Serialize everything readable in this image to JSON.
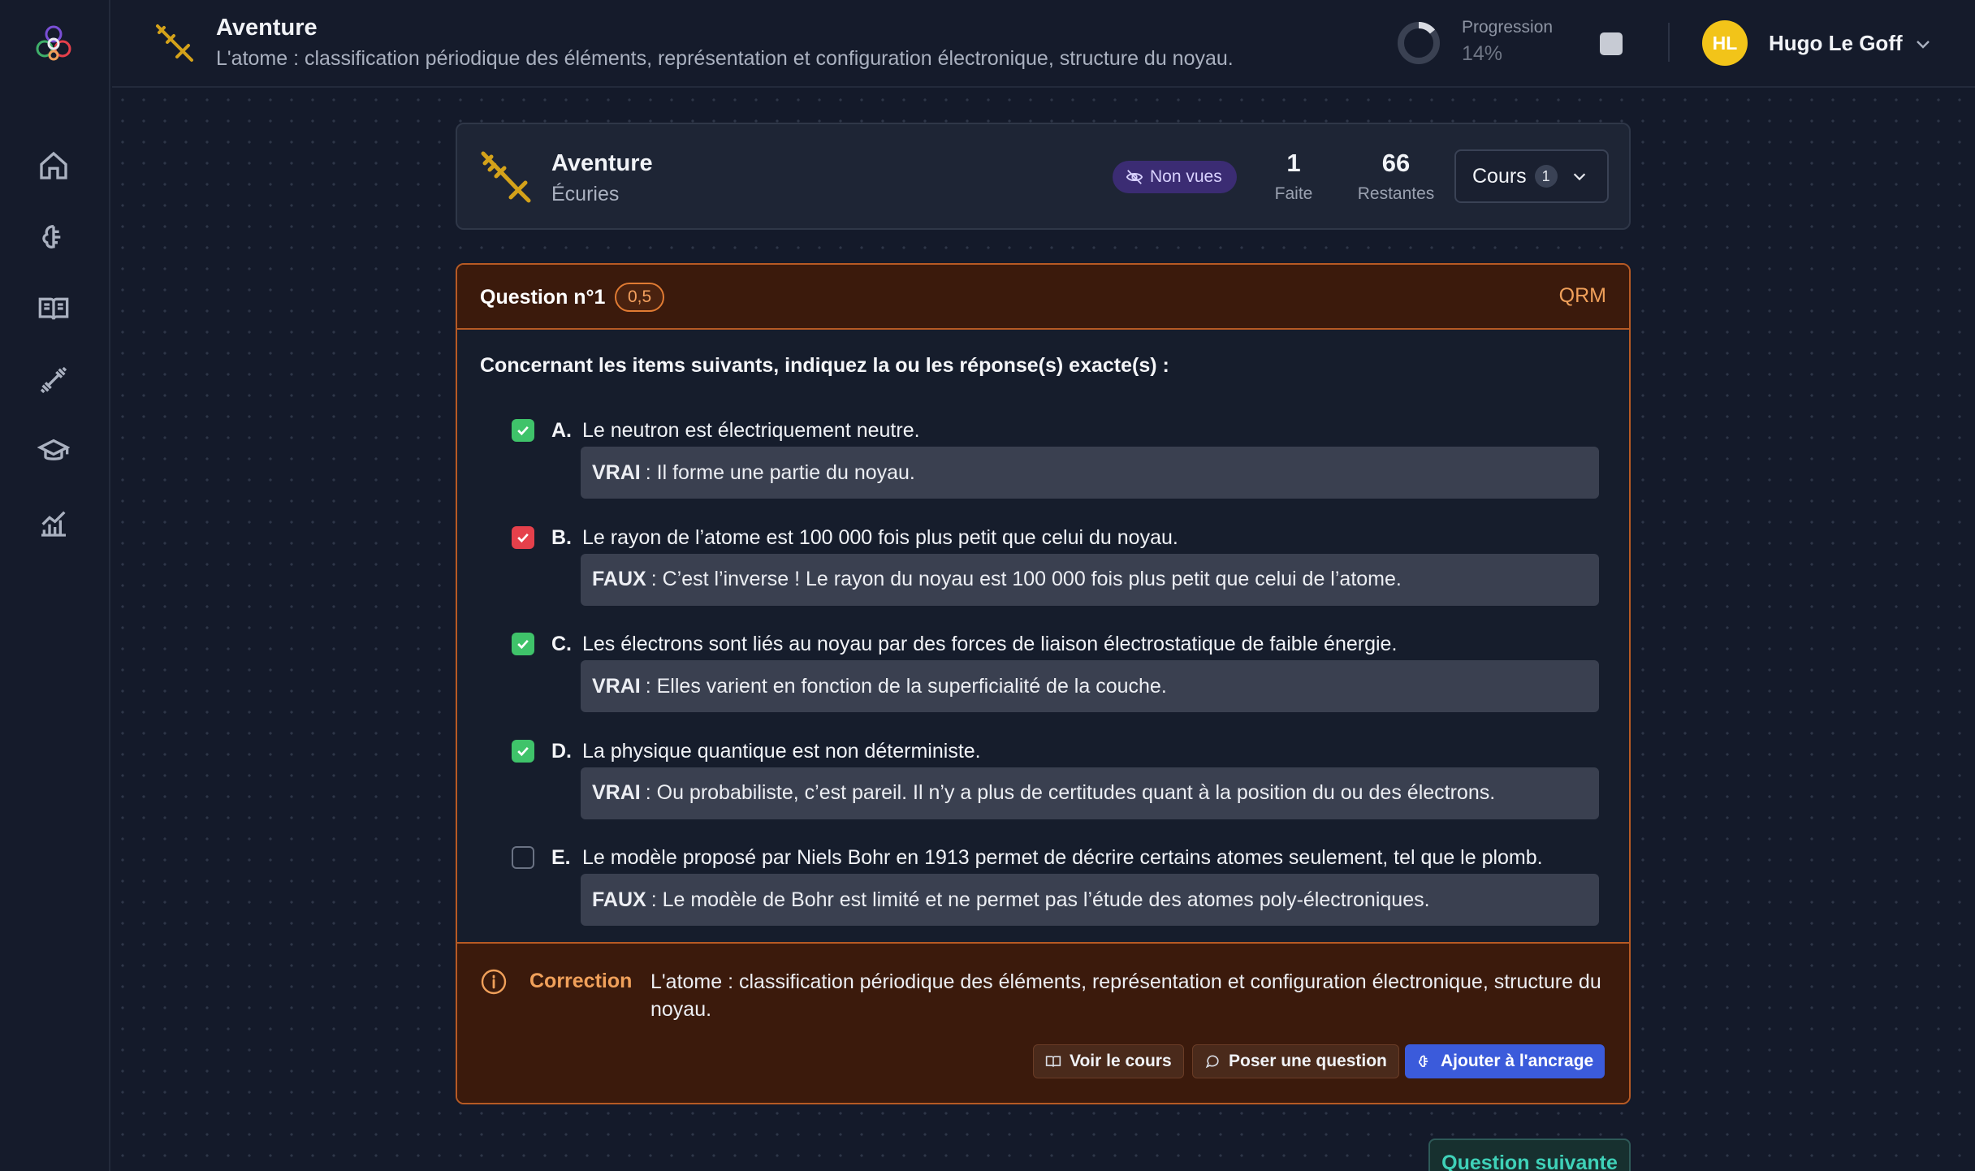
{
  "header": {
    "title": "Aventure",
    "subtitle": "L'atome : classification périodique des éléments, représentation et configuration électronique, structure du noyau.",
    "progress_label": "Progression",
    "progress_value": "14%",
    "progress_fraction": 0.14,
    "user_initials": "HL",
    "user_name": "Hugo Le Goff"
  },
  "sidebar": {
    "items": [
      {
        "icon": "home-icon"
      },
      {
        "icon": "brain-icon"
      },
      {
        "icon": "book-icon"
      },
      {
        "icon": "dumbbell-icon"
      },
      {
        "icon": "graduation-cap-icon"
      },
      {
        "icon": "stats-chart-icon"
      }
    ]
  },
  "adventure": {
    "title": "Aventure",
    "subtitle": "Écuries",
    "badge": "Non vues",
    "done_count": "1",
    "done_label": "Faite",
    "remaining_count": "66",
    "remaining_label": "Restantes",
    "courses_label": "Cours",
    "courses_count": "1"
  },
  "question": {
    "title": "Question n°1",
    "points": "0,5",
    "type": "QRM",
    "prompt": "Concernant les items suivants, indiquez la ou les réponse(s) exacte(s) :",
    "items": [
      {
        "letter": "A.",
        "state": "correct",
        "text": "Le neutron est électriquement neutre.",
        "verdict": "VRAI",
        "explanation": ": Il forme une partie du noyau."
      },
      {
        "letter": "B.",
        "state": "wrong",
        "text": "Le rayon de l’atome est 100 000 fois plus petit que celui du noyau.",
        "verdict": "FAUX",
        "explanation": ": C’est l’inverse ! Le rayon du noyau est 100 000 fois plus petit que celui de l’atome."
      },
      {
        "letter": "C.",
        "state": "correct",
        "text": "Les électrons sont liés au noyau par des forces de liaison électrostatique de faible énergie.",
        "verdict": "VRAI",
        "explanation": ": Elles varient en fonction de la superficialité de la couche."
      },
      {
        "letter": "D.",
        "state": "correct",
        "text": "La physique quantique est non déterministe.",
        "verdict": "VRAI",
        "explanation": ": Ou probabiliste, c’est pareil. Il n’y a plus de certitudes quant à la position du ou des électrons."
      },
      {
        "letter": "E.",
        "state": "unchecked",
        "text": "Le modèle proposé par Niels Bohr en 1913 permet de décrire certains atomes seulement, tel que le plomb.",
        "verdict": "FAUX",
        "explanation": ": Le modèle de Bohr est limité et ne permet pas l’étude des atomes poly-électroniques."
      }
    ]
  },
  "correction": {
    "label": "Correction",
    "text": "L'atome : classification périodique des éléments, représentation et configuration électronique, structure du noyau.",
    "view_course": "Voir le cours",
    "ask_question": "Poser une question",
    "add_anchor": "Ajouter à l'ancrage"
  },
  "next_button": "Question suivante",
  "colors": {
    "accent_orange": "#b75a24",
    "correct_green": "#3fc36a",
    "wrong_red": "#e5404b",
    "primary_blue": "#3b5bdb",
    "badge_purple": "#3b2c73",
    "avatar_yellow": "#f2c419",
    "teal": "#3fd1b8"
  }
}
